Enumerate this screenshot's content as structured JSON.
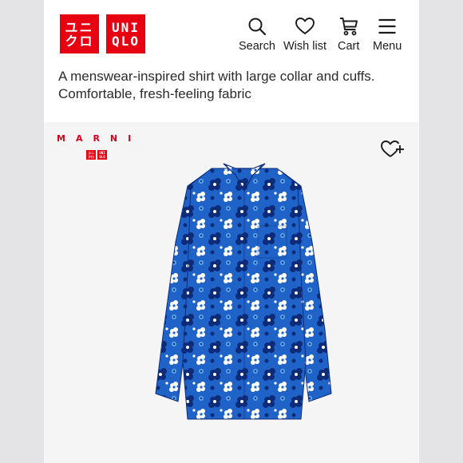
{
  "brand": {
    "logo_left": [
      "ユニ",
      "クロ"
    ],
    "logo_right": [
      "UNI",
      "QLO"
    ],
    "red": "#e60012"
  },
  "nav": {
    "search": "Search",
    "wishlist": "Wish list",
    "cart": "Cart",
    "menu": "Menu"
  },
  "product": {
    "description": "A menswear-inspired shirt with large collar and cuffs. Comfortable, fresh-feeling fabric",
    "collab_brand": "MARNI",
    "image_icon": "shirt-image",
    "favorite_icon": "heart-plus-icon",
    "shirt_colors": [
      "#1f63c9",
      "#0e2b7a",
      "#ffffff",
      "#5aa8e8"
    ]
  }
}
